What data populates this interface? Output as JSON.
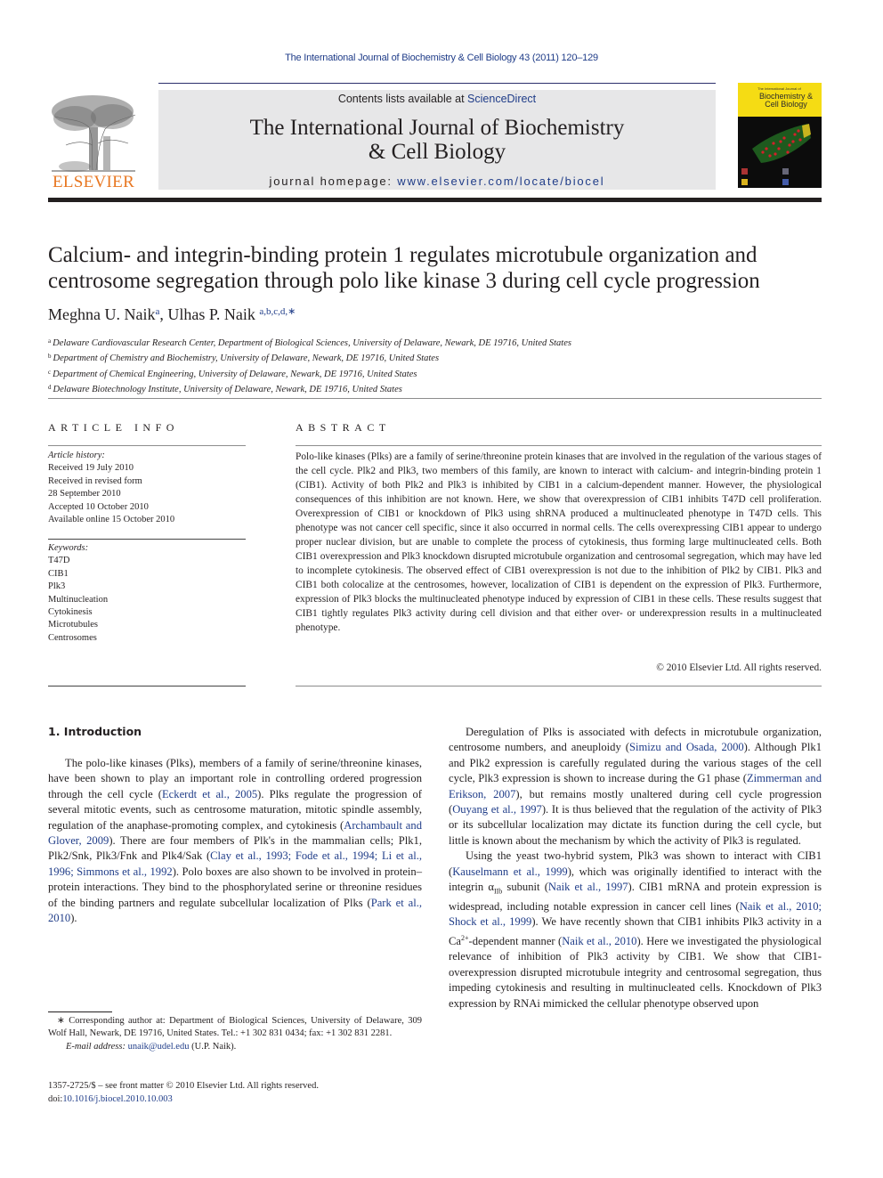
{
  "running_header": "The International Journal of Biochemistry & Cell Biology 43 (2011) 120–129",
  "publisher": {
    "logo_word": "ELSEVIER",
    "colors": {
      "logo_orange": "#e87722",
      "link_blue": "#1f3c88",
      "header_gray": "#e7e7e8"
    }
  },
  "masthead": {
    "contents_prefix": "Contents lists available at ",
    "contents_link": "ScienceDirect",
    "journal_title_line1": "The International Journal of Biochemistry",
    "journal_title_line2": "& Cell Biology",
    "homepage_prefix": "journal homepage: ",
    "homepage_link": "www.elsevier.com/locate/biocel"
  },
  "cover": {
    "small_text": "The International Journal of",
    "title_line1": "Biochemistry &",
    "title_line2": "Cell Biology"
  },
  "article": {
    "title_line1": "Calcium- and integrin-binding protein 1 regulates microtubule organization and",
    "title_line2": "centrosome segregation through polo like kinase 3 during cell cycle progression",
    "authors": [
      {
        "name": "Meghna U. Naik",
        "sup": "a"
      },
      {
        "name": "Ulhas P. Naik",
        "sup": "a,b,c,d,∗"
      }
    ],
    "author_separator": ", ",
    "affiliations": [
      {
        "mark": "a",
        "text": "Delaware Cardiovascular Research Center, Department of Biological Sciences, University of Delaware, Newark, DE 19716, United States"
      },
      {
        "mark": "b",
        "text": "Department of Chemistry and Biochemistry, University of Delaware, Newark, DE 19716, United States"
      },
      {
        "mark": "c",
        "text": "Department of Chemical Engineering, University of Delaware, Newark, DE 19716, United States"
      },
      {
        "mark": "d",
        "text": "Delaware Biotechnology Institute, University of Delaware, Newark, DE 19716, United States"
      }
    ]
  },
  "article_info": {
    "heading": "ARTICLE INFO",
    "history_label": "Article history:",
    "history": [
      "Received 19 July 2010",
      "Received in revised form",
      "28 September 2010",
      "Accepted 10 October 2010",
      "Available online 15 October 2010"
    ],
    "keywords_label": "Keywords:",
    "keywords": [
      "T47D",
      "CIB1",
      "Plk3",
      "Multinucleation",
      "Cytokinesis",
      "Microtubules",
      "Centrosomes"
    ]
  },
  "abstract": {
    "heading": "ABSTRACT",
    "text": "Polo-like kinases (Plks) are a family of serine/threonine protein kinases that are involved in the regulation of the various stages of the cell cycle. Plk2 and Plk3, two members of this family, are known to interact with calcium- and integrin-binding protein 1 (CIB1). Activity of both Plk2 and Plk3 is inhibited by CIB1 in a calcium-dependent manner. However, the physiological consequences of this inhibition are not known. Here, we show that overexpression of CIB1 inhibits T47D cell proliferation. Overexpression of CIB1 or knockdown of Plk3 using shRNA produced a multinucleated phenotype in T47D cells. This phenotype was not cancer cell specific, since it also occurred in normal cells. The cells overexpressing CIB1 appear to undergo proper nuclear division, but are unable to complete the process of cytokinesis, thus forming large multinucleated cells. Both CIB1 overexpression and Plk3 knockdown disrupted microtubule organization and centrosomal segregation, which may have led to incomplete cytokinesis. The observed effect of CIB1 overexpression is not due to the inhibition of Plk2 by CIB1. Plk3 and CIB1 both colocalize at the centrosomes, however, localization of CIB1 is dependent on the expression of Plk3. Furthermore, expression of Plk3 blocks the multinucleated phenotype induced by expression of CIB1 in these cells. These results suggest that CIB1 tightly regulates Plk3 activity during cell division and that either over- or underexpression results in a multinucleated phenotype.",
    "copyright": "© 2010 Elsevier Ltd. All rights reserved."
  },
  "body": {
    "section_heading": "1.  Introduction",
    "left_para": [
      {
        "t": "The polo-like kinases (Plks), members of a family of serine/threonine kinases, have been shown to play an important role in controlling ordered progression through the cell cycle ("
      },
      {
        "link": "Eckerdt et al., 2005"
      },
      {
        "t": "). Plks regulate the progression of several mitotic events, such as centrosome maturation, mitotic spindle assembly, regulation of the anaphase-promoting complex, and cytokinesis ("
      },
      {
        "link": "Archambault and Glover, 2009"
      },
      {
        "t": "). There are four members of Plk's in the mammalian cells; Plk1, Plk2/Snk, Plk3/Fnk and Plk4/Sak ("
      },
      {
        "link": "Clay et al., 1993; Fode et al., 1994; Li et al., 1996; Simmons et al., 1992"
      },
      {
        "t": "). Polo boxes are also shown to be involved in protein–protein interactions. They bind to the phosphorylated serine or threonine residues of the binding partners and regulate subcellular localization of Plks ("
      },
      {
        "link": "Park et al., 2010"
      },
      {
        "t": ")."
      }
    ],
    "right_para1": [
      {
        "t": "Deregulation of Plks is associated with defects in microtubule organization, centrosome numbers, and aneuploidy ("
      },
      {
        "link": "Simizu and Osada, 2000"
      },
      {
        "t": "). Although Plk1 and Plk2 expression is carefully regulated during the various stages of the cell cycle, Plk3 expression is shown to increase during the G1 phase ("
      },
      {
        "link": "Zimmerman and Erikson, 2007"
      },
      {
        "t": "), but remains mostly unaltered during cell cycle progression ("
      },
      {
        "link": "Ouyang et al., 1997"
      },
      {
        "t": "). It is thus believed that the regulation of the activity of Plk3 or its subcellular localization may dictate its function during the cell cycle, but little is known about the mechanism by which the activity of Plk3 is regulated."
      }
    ],
    "right_para2": [
      {
        "t": "Using the yeast two-hybrid system, Plk3 was shown to interact with CIB1 ("
      },
      {
        "link": "Kauselmann et al., 1999"
      },
      {
        "t": "), which was originally identified to interact with the integrin α"
      },
      {
        "sub": "IIb"
      },
      {
        "t": " subunit ("
      },
      {
        "link": "Naik et al., 1997"
      },
      {
        "t": "). CIB1 mRNA and protein expression is widespread, including notable expression in cancer cell lines ("
      },
      {
        "link": "Naik et al., 2010; Shock et al., 1999"
      },
      {
        "t": "). We have recently shown that CIB1 inhibits Plk3 activity in a Ca"
      },
      {
        "sup": "2+"
      },
      {
        "t": "-dependent manner ("
      },
      {
        "link": "Naik et al., 2010"
      },
      {
        "t": "). Here we investigated the physiological relevance of inhibition of Plk3 activity by CIB1. We show that CIB1-overexpression disrupted microtubule integrity and centrosomal segregation, thus impeding cytokinesis and resulting in multinucleated cells. Knockdown of Plk3 expression by RNAi mimicked the cellular phenotype observed upon"
      }
    ]
  },
  "footnote": {
    "corresponding": "∗ Corresponding author at: Department of Biological Sciences, University of Delaware, 309 Wolf Hall, Newark, DE 19716, United States. Tel.: +1 302 831 0434; fax: +1 302 831 2281.",
    "email_label": "E-mail address: ",
    "email": "unaik@udel.edu",
    "email_suffix": " (U.P. Naik)."
  },
  "footer": {
    "issn_line": "1357-2725/$ – see front matter © 2010 Elsevier Ltd. All rights reserved.",
    "doi_prefix": "doi:",
    "doi": "10.1016/j.biocel.2010.10.003"
  }
}
